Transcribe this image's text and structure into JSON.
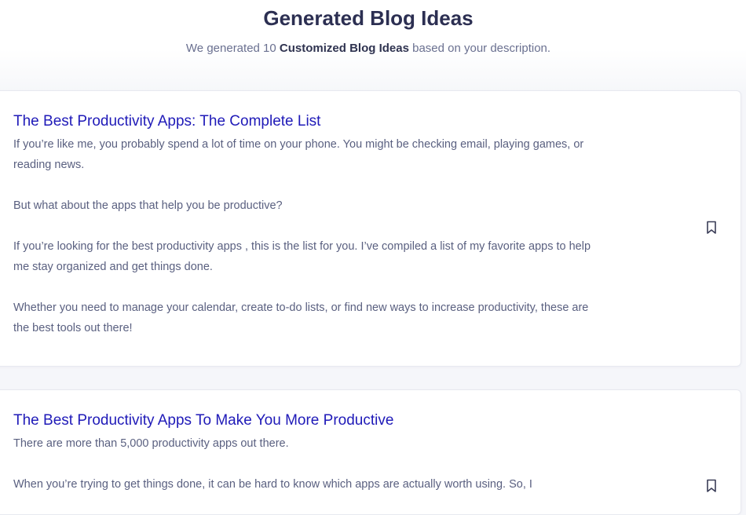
{
  "header": {
    "title": "Generated Blog Ideas",
    "subtitle_pre": "We generated 10 ",
    "subtitle_strong": "Customized Blog Ideas",
    "subtitle_post": " based on your description."
  },
  "ideas": [
    {
      "title": "The Best Productivity Apps: The Complete List",
      "paragraphs": [
        "If you’re like me, you probably spend a lot of time on your phone. You might be checking email, playing games, or reading news.",
        "But what about the apps that help you be productive?",
        "If you’re looking for the best productivity apps , this is the list for you. I’ve compiled a list of my favorite apps to help me stay organized and get things done.",
        "Whether you need to manage your calendar, create to-do lists, or find new ways to increase productivity, these are the best tools out there!"
      ],
      "bookmark_icon": "bookmark-icon"
    },
    {
      "title": "The Best Productivity Apps To Make You More Productive",
      "paragraphs": [
        "There are more than 5,000 productivity apps out there.",
        "When you’re trying to get things done, it can be hard to know which apps are actually worth using. So, I"
      ],
      "bookmark_icon": "bookmark-icon"
    }
  ],
  "colors": {
    "title": "#2c2f52",
    "link": "#1f1ab8",
    "body_text": "#5a6080",
    "background": "#f5f6fa",
    "card": "#ffffff"
  }
}
